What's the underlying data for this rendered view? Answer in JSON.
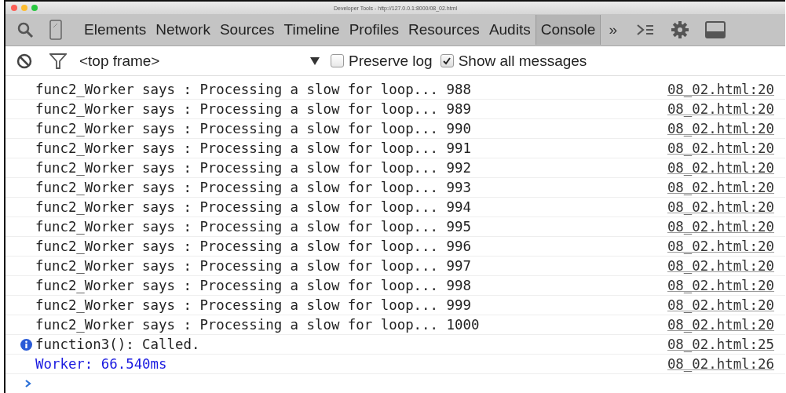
{
  "window": {
    "title": "Developer Tools - http://127.0.0.1:8000/08_02.html"
  },
  "tabs": [
    {
      "label": "Elements",
      "selected": false
    },
    {
      "label": "Network",
      "selected": false
    },
    {
      "label": "Sources",
      "selected": false
    },
    {
      "label": "Timeline",
      "selected": false
    },
    {
      "label": "Profiles",
      "selected": false
    },
    {
      "label": "Resources",
      "selected": false
    },
    {
      "label": "Audits",
      "selected": false
    },
    {
      "label": "Console",
      "selected": true
    }
  ],
  "more_tabs": "»",
  "filter_bar": {
    "context": "<top frame>",
    "options": [
      {
        "label": "Preserve log",
        "checked": false
      },
      {
        "label": "Show all messages",
        "checked": true
      }
    ]
  },
  "messages": [
    {
      "kind": "log",
      "text": "func2_Worker says : Processing a slow for loop... 988",
      "source": "08_02.html:20"
    },
    {
      "kind": "log",
      "text": "func2_Worker says : Processing a slow for loop... 989",
      "source": "08_02.html:20"
    },
    {
      "kind": "log",
      "text": "func2_Worker says : Processing a slow for loop... 990",
      "source": "08_02.html:20"
    },
    {
      "kind": "log",
      "text": "func2_Worker says : Processing a slow for loop... 991",
      "source": "08_02.html:20"
    },
    {
      "kind": "log",
      "text": "func2_Worker says : Processing a slow for loop... 992",
      "source": "08_02.html:20"
    },
    {
      "kind": "log",
      "text": "func2_Worker says : Processing a slow for loop... 993",
      "source": "08_02.html:20"
    },
    {
      "kind": "log",
      "text": "func2_Worker says : Processing a slow for loop... 994",
      "source": "08_02.html:20"
    },
    {
      "kind": "log",
      "text": "func2_Worker says : Processing a slow for loop... 995",
      "source": "08_02.html:20"
    },
    {
      "kind": "log",
      "text": "func2_Worker says : Processing a slow for loop... 996",
      "source": "08_02.html:20"
    },
    {
      "kind": "log",
      "text": "func2_Worker says : Processing a slow for loop... 997",
      "source": "08_02.html:20"
    },
    {
      "kind": "log",
      "text": "func2_Worker says : Processing a slow for loop... 998",
      "source": "08_02.html:20"
    },
    {
      "kind": "log",
      "text": "func2_Worker says : Processing a slow for loop... 999",
      "source": "08_02.html:20"
    },
    {
      "kind": "log",
      "text": "func2_Worker says : Processing a slow for loop... 1000",
      "source": "08_02.html:20"
    },
    {
      "kind": "info",
      "text": "function3(): Called.",
      "source": "08_02.html:25"
    },
    {
      "kind": "timing",
      "text": "Worker: 66.540ms",
      "source": "08_02.html:26"
    }
  ]
}
